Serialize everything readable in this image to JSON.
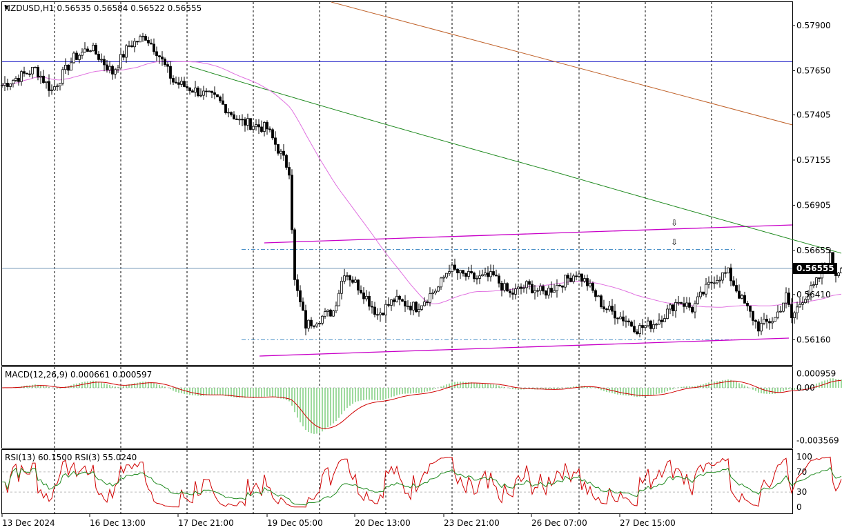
{
  "chart_data": [
    {
      "type": "candlestick",
      "title": "NZDUSD,H1  0.56535 0.56584 0.56522 0.56555",
      "ylim": [
        0.5602,
        0.5803
      ],
      "yticks": [
        "0.57900",
        "0.57650",
        "0.57405",
        "0.57155",
        "0.56905",
        "0.56655",
        "0.56410",
        "0.56160"
      ],
      "ytick_values": [
        0.579,
        0.5765,
        0.57405,
        0.57155,
        0.56905,
        0.56655,
        0.5641,
        0.5616
      ],
      "last_price": "0.56555",
      "last_price_value": 0.56555,
      "candle_count": 233,
      "anchors": [
        [
          0,
          0.5757
        ],
        [
          12,
          0.5766
        ],
        [
          18,
          0.5754
        ],
        [
          26,
          0.5772
        ],
        [
          32,
          0.5778
        ],
        [
          40,
          0.5764
        ],
        [
          46,
          0.5779
        ],
        [
          52,
          0.5784
        ],
        [
          56,
          0.5776
        ],
        [
          62,
          0.5759
        ],
        [
          70,
          0.5754
        ],
        [
          78,
          0.5749
        ],
        [
          86,
          0.5737
        ],
        [
          96,
          0.5733
        ],
        [
          104,
          0.571
        ],
        [
          106,
          0.5648
        ],
        [
          110,
          0.5624
        ],
        [
          120,
          0.5632
        ],
        [
          124,
          0.5654
        ],
        [
          130,
          0.5644
        ],
        [
          136,
          0.563
        ],
        [
          142,
          0.5638
        ],
        [
          150,
          0.5634
        ],
        [
          158,
          0.5645
        ],
        [
          162,
          0.5656
        ],
        [
          166,
          0.5652
        ],
        [
          172,
          0.565
        ],
        [
          178,
          0.5651
        ],
        [
          184,
          0.5641
        ],
        [
          190,
          0.5646
        ],
        [
          196,
          0.5642
        ],
        [
          200,
          0.5645
        ],
        [
          208,
          0.5653
        ],
        [
          212,
          0.5647
        ],
        [
          218,
          0.5634
        ],
        [
          226,
          0.5627
        ],
        [
          230,
          0.5622
        ],
        [
          236,
          0.5625
        ],
        [
          240,
          0.563
        ],
        [
          245,
          0.5638
        ],
        [
          250,
          0.5633
        ],
        [
          254,
          0.5642
        ],
        [
          258,
          0.565
        ],
        [
          263,
          0.5653
        ],
        [
          268,
          0.5638
        ],
        [
          274,
          0.5623
        ],
        [
          280,
          0.5628
        ],
        [
          284,
          0.564
        ],
        [
          286,
          0.5628
        ],
        [
          290,
          0.5639
        ],
        [
          294,
          0.5645
        ],
        [
          298,
          0.5656
        ],
        [
          300,
          0.5662
        ],
        [
          302,
          0.5653
        ],
        [
          304,
          0.5656
        ]
      ],
      "timeline_anchors": [
        [
          0,
          0.5757
        ],
        [
          12,
          0.5766
        ],
        [
          18,
          0.5754
        ],
        [
          26,
          0.5772
        ],
        [
          32,
          0.5778
        ],
        [
          40,
          0.5764
        ],
        [
          46,
          0.5779
        ],
        [
          52,
          0.5784
        ],
        [
          56,
          0.5776
        ],
        [
          62,
          0.5759
        ],
        [
          70,
          0.5754
        ],
        [
          78,
          0.5749
        ],
        [
          86,
          0.5737
        ],
        [
          96,
          0.5733
        ],
        [
          104,
          0.571
        ],
        [
          106,
          0.5648
        ],
        [
          110,
          0.5624
        ],
        [
          120,
          0.5632
        ],
        [
          124,
          0.5654
        ],
        [
          130,
          0.5644
        ],
        [
          136,
          0.563
        ],
        [
          142,
          0.5638
        ],
        [
          150,
          0.5634
        ],
        [
          158,
          0.5645
        ],
        [
          162,
          0.5656
        ],
        [
          166,
          0.5652
        ],
        [
          172,
          0.565
        ],
        [
          178,
          0.5651
        ],
        [
          184,
          0.5641
        ],
        [
          190,
          0.5646
        ],
        [
          196,
          0.5642
        ],
        [
          200,
          0.5645
        ],
        [
          208,
          0.5653
        ],
        [
          212,
          0.5647
        ],
        [
          218,
          0.5634
        ],
        [
          226,
          0.5627
        ],
        [
          230,
          0.5622
        ],
        [
          236,
          0.5625
        ],
        [
          240,
          0.563
        ],
        [
          245,
          0.5638
        ],
        [
          250,
          0.5633
        ],
        [
          254,
          0.5642
        ],
        [
          258,
          0.565
        ],
        [
          263,
          0.5653
        ],
        [
          268,
          0.5638
        ],
        [
          274,
          0.5623
        ],
        [
          280,
          0.5628
        ],
        [
          284,
          0.564
        ],
        [
          286,
          0.5628
        ],
        [
          290,
          0.5639
        ],
        [
          294,
          0.5645
        ],
        [
          298,
          0.5656
        ],
        [
          300,
          0.5662
        ],
        [
          302,
          0.5653
        ],
        [
          304,
          0.5656
        ]
      ],
      "hlines": [
        {
          "name": "resistance-level-blue",
          "value": 0.577,
          "color": "#1b1bc4"
        },
        {
          "name": "range-top-dashed",
          "value": 0.5666,
          "color": "#4a90c8"
        },
        {
          "name": "range-bottom-dashed",
          "value": 0.5616,
          "color": "#4a90c8"
        }
      ],
      "trendlines": [
        {
          "name": "brown-trendline",
          "color": "#c0622a",
          "from": [
            0.5803,
            0
          ],
          "to": [
            0.574,
            0
          ]
        },
        {
          "name": "magenta-channel-top",
          "color": "#c800c8"
        },
        {
          "name": "magenta-channel-bottom",
          "color": "#c800c8"
        }
      ],
      "signal_arrows": [
        "⇩",
        "⇩"
      ],
      "colors": {
        "up": "#000000",
        "down": "#000000",
        "upFill": "#ffffff",
        "downFill": "#000000",
        "ma_slow": "#1f8a1f",
        "ma_fast": "#e070e0",
        "grid": "#000000"
      }
    },
    {
      "type": "histogram",
      "title": "MACD(12,26,9) 0.000661 0.000597",
      "yticks": [
        "0.000959",
        "0.00",
        "-0.003569"
      ],
      "ytick_values": [
        0.000959,
        0.0,
        -0.003569
      ],
      "ylim": [
        -0.004,
        0.0013
      ],
      "colors": {
        "histogram": "#3cb43c",
        "signal": "#d00000"
      }
    },
    {
      "type": "line",
      "title": "RSI(13) 60.1500  RSI(3) 55.0240",
      "yticks": [
        "100",
        "70",
        "30",
        "0"
      ],
      "ytick_values": [
        100,
        70,
        30,
        0
      ],
      "ylim": [
        0,
        100
      ],
      "series": [
        {
          "name": "RSI(13)",
          "color": "#1f8a1f"
        },
        {
          "name": "RSI(3)",
          "color": "#d00000"
        }
      ]
    }
  ],
  "xaxis": {
    "labels": [
      "13 Dec 2024",
      "16 Dec 13:00",
      "17 Dec 21:00",
      "19 Dec 05:00",
      "20 Dec 13:00",
      "23 Dec 21:00",
      "26 Dec 07:00",
      "27 Dec 15:00"
    ]
  }
}
